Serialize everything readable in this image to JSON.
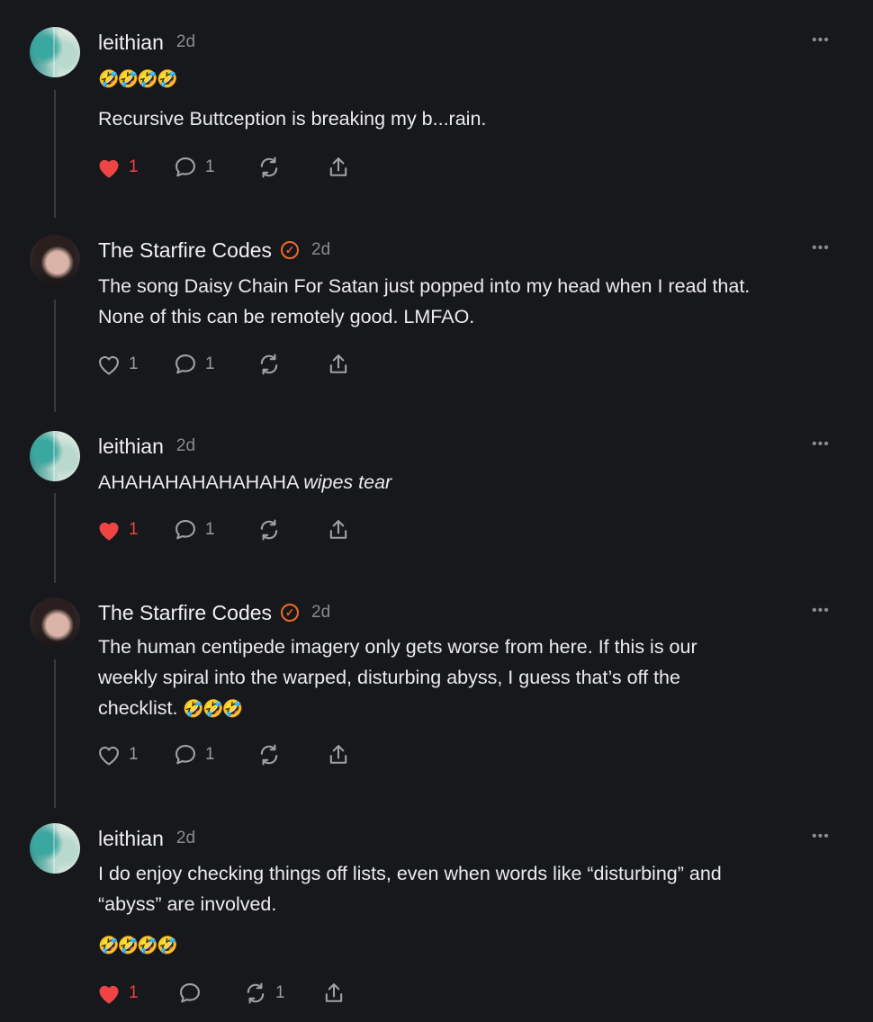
{
  "comments": [
    {
      "author": "leithian",
      "verified": false,
      "time": "2d",
      "emoji_line": "🤣🤣🤣🤣",
      "text": "Recursive Buttception is breaking my b...rain.",
      "likes": "1",
      "liked": true,
      "replies": "1",
      "restacks": ""
    },
    {
      "author": "The Starfire Codes",
      "verified": true,
      "time": "2d",
      "text_line1": "The song Daisy Chain For Satan just popped into my head when I read that.",
      "text_line2": "None of this can be remotely good. LMFAO.",
      "likes": "1",
      "liked": false,
      "replies": "1",
      "restacks": ""
    },
    {
      "author": "leithian",
      "verified": false,
      "time": "2d",
      "text_plain": "AHAHAHAHAHAHAHA ",
      "text_italic": "wipes tear",
      "likes": "1",
      "liked": true,
      "replies": "1",
      "restacks": ""
    },
    {
      "author": "The Starfire Codes",
      "verified": true,
      "time": "2d",
      "text_line1": "The human centipede imagery only gets worse from here. If this is our",
      "text_line2": "weekly spiral into the warped, disturbing abyss, I guess that’s off the",
      "text_line3": "checklist. ",
      "emoji_inline": "🤣🤣🤣",
      "likes": "1",
      "liked": false,
      "replies": "1",
      "restacks": ""
    },
    {
      "author": "leithian",
      "verified": false,
      "time": "2d",
      "text_line1": "I do enjoy checking things off lists, even when words like “disturbing” and",
      "text_line2": "“abyss” are involved.",
      "emoji_line": "🤣🤣🤣🤣",
      "likes": "1",
      "liked": true,
      "replies": "",
      "restacks": "1"
    }
  ],
  "more_label": "•••",
  "verified_glyph": "✓",
  "icons": [
    "heart-icon",
    "comment-icon",
    "restack-icon",
    "share-icon",
    "more-icon",
    "verified-icon"
  ],
  "colors": {
    "background": "#17181b",
    "liked": "#ef4444",
    "muted": "#8a8b8f",
    "verified": "#f06a25"
  }
}
